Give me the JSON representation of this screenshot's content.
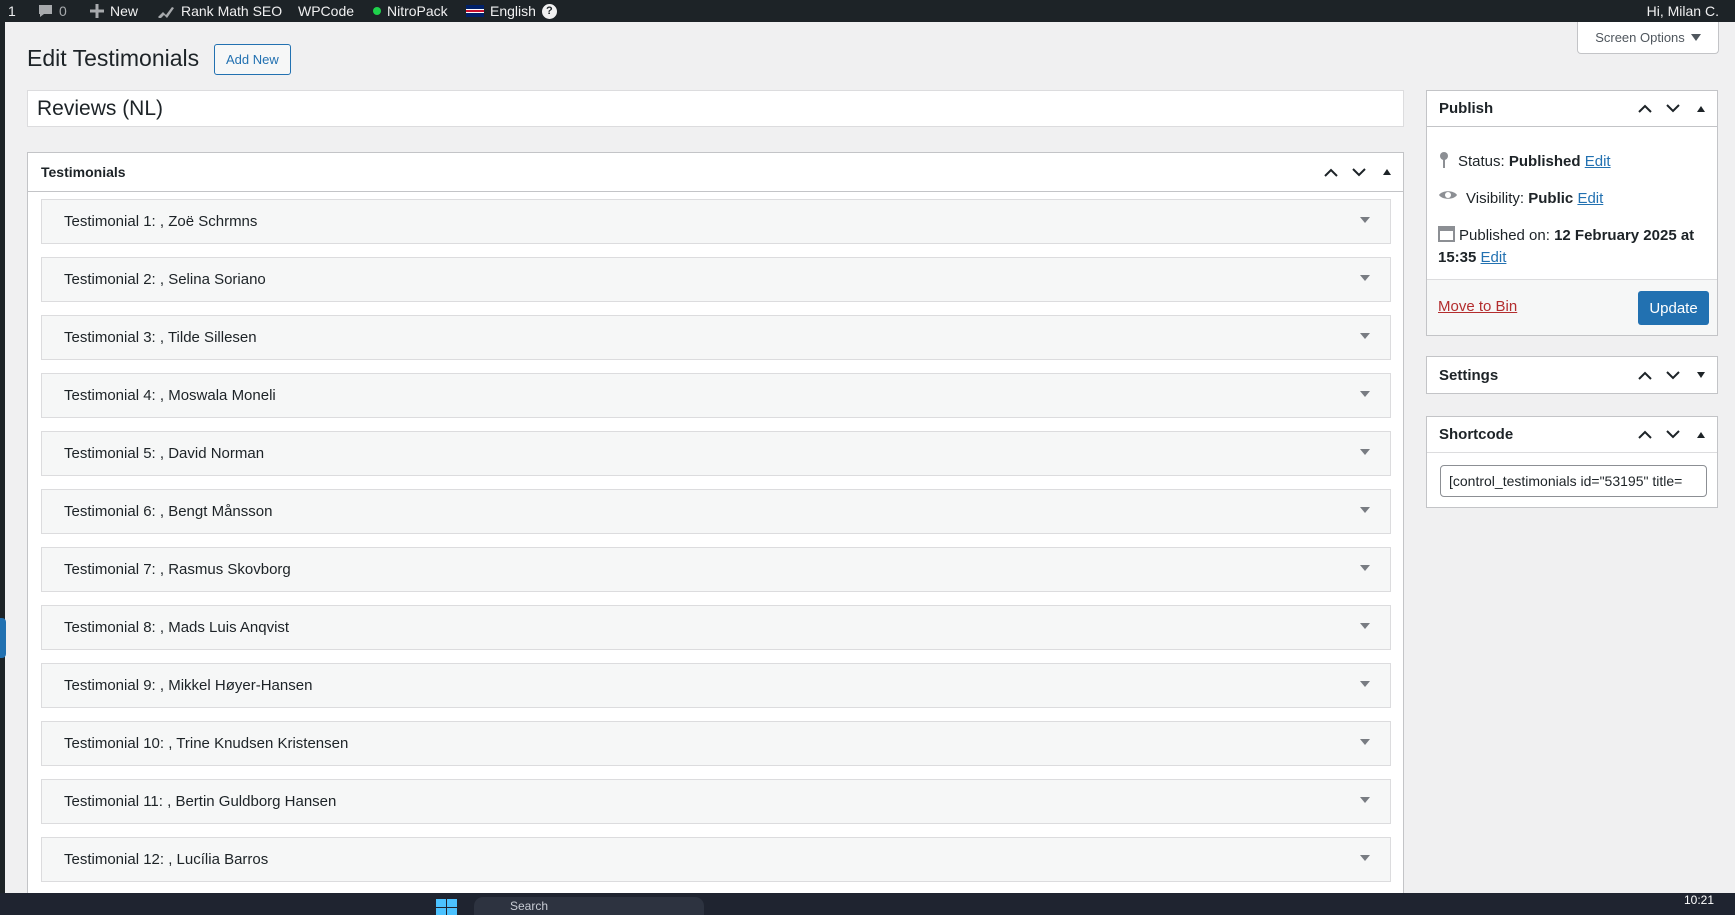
{
  "adminbar": {
    "updates_count": "1",
    "comments_count": "0",
    "new_label": "New",
    "rankmath_label": "Rank Math SEO",
    "wpcode_label": "WPCode",
    "nitropack_label": "NitroPack",
    "language_label": "English",
    "greeting": "Hi, Milan C."
  },
  "header": {
    "title": "Edit Testimonials",
    "add_new_label": "Add New",
    "screen_options_label": "Screen Options"
  },
  "post": {
    "title": "Reviews (NL)"
  },
  "testimonials_box": {
    "title": "Testimonials",
    "items": [
      {
        "label": "Testimonial 1: , Zoë Schrmns"
      },
      {
        "label": "Testimonial 2: , Selina Soriano"
      },
      {
        "label": "Testimonial 3: , Tilde Sillesen"
      },
      {
        "label": "Testimonial 4: , Moswala Moneli"
      },
      {
        "label": "Testimonial 5: , David Norman"
      },
      {
        "label": "Testimonial 6: , Bengt Månsson"
      },
      {
        "label": "Testimonial 7: , Rasmus Skovborg"
      },
      {
        "label": "Testimonial 8: , Mads Luis Anqvist"
      },
      {
        "label": "Testimonial 9: , Mikkel Høyer-Hansen"
      },
      {
        "label": "Testimonial 10: , Trine Knudsen Kristensen"
      },
      {
        "label": "Testimonial 11: , Bertin Guldborg Hansen"
      },
      {
        "label": "Testimonial 12: , Lucília Barros"
      }
    ]
  },
  "publish": {
    "title": "Publish",
    "status_label": "Status:",
    "status_value": "Published",
    "visibility_label": "Visibility:",
    "visibility_value": "Public",
    "published_on_label": "Published on:",
    "published_on_value": "12 February 2025 at 15:35",
    "edit_label": "Edit",
    "move_to_bin_label": "Move to Bin",
    "update_label": "Update"
  },
  "settings": {
    "title": "Settings"
  },
  "shortcode": {
    "title": "Shortcode",
    "value": "[control_testimonials id=\"53195\" title="
  },
  "taskbar": {
    "search_placeholder": "Search",
    "time": "10:21"
  }
}
